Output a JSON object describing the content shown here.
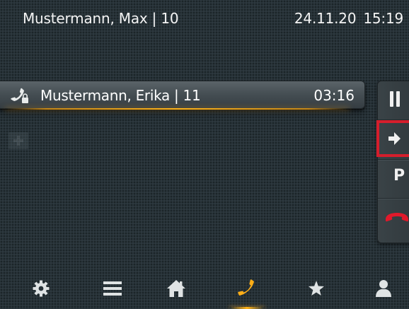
{
  "header": {
    "user": "Mustermann, Max | 10",
    "date": "24.11.20",
    "time": "15:19"
  },
  "active_call": {
    "name": "Mustermann, Erika | 11",
    "duration": "03:16",
    "icon": "handset-lock-icon",
    "secured": true
  },
  "call_controls": [
    {
      "id": "hold",
      "icon": "pause-icon",
      "label": ""
    },
    {
      "id": "transfer",
      "icon": "arrow-right-icon",
      "label": "",
      "selected": true
    },
    {
      "id": "park",
      "icon": "",
      "label": "P"
    },
    {
      "id": "hangup",
      "icon": "hangup-icon",
      "label": ""
    }
  ],
  "add_call": {
    "icon": "plus-icon"
  },
  "nav": {
    "items": [
      {
        "id": "settings",
        "icon": "gear-icon"
      },
      {
        "id": "menu",
        "icon": "menu-icon"
      },
      {
        "id": "home",
        "icon": "home-icon"
      },
      {
        "id": "calls",
        "icon": "phone-icon",
        "active": true
      },
      {
        "id": "favorites",
        "icon": "star-icon"
      },
      {
        "id": "contacts",
        "icon": "person-icon"
      }
    ]
  },
  "colors": {
    "background": "#273238",
    "text": "#f2f2f2",
    "accent": "#ffb31a",
    "selection": "#d51e2c",
    "hangup": "#e0192b",
    "icon": "#dfe3e4"
  }
}
